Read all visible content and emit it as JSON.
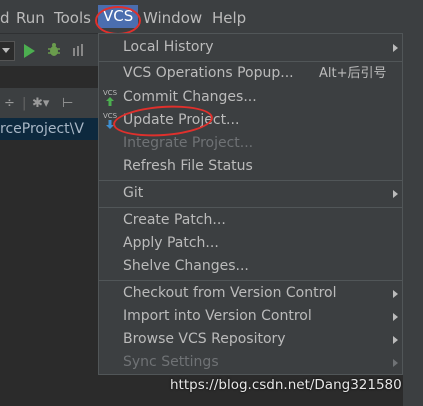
{
  "menubar": {
    "items": [
      "d",
      "Run",
      "Tools",
      "VCS",
      "Window",
      "Help"
    ]
  },
  "left_panel": {
    "project_path": "rceProject\\V"
  },
  "vcs_menu": {
    "items": [
      {
        "label": "Local History",
        "has_submenu": true,
        "enabled": true
      },
      {
        "label": "VCS Operations Popup...",
        "shortcut": "Alt+后引号",
        "enabled": true
      },
      {
        "label": "Commit Changes...",
        "icon": "vcs-commit-icon",
        "enabled": true
      },
      {
        "label": "Update Project...",
        "icon": "vcs-update-icon",
        "enabled": true
      },
      {
        "label": "Integrate Project...",
        "enabled": false
      },
      {
        "label": "Refresh File Status",
        "enabled": true
      },
      {
        "label": "Git",
        "has_submenu": true,
        "enabled": true
      },
      {
        "label": "Create Patch...",
        "enabled": true
      },
      {
        "label": "Apply Patch...",
        "enabled": true
      },
      {
        "label": "Shelve Changes...",
        "enabled": true
      },
      {
        "label": "Checkout from Version Control",
        "has_submenu": true,
        "enabled": true
      },
      {
        "label": "Import into Version Control",
        "has_submenu": true,
        "enabled": true
      },
      {
        "label": "Browse VCS Repository",
        "has_submenu": true,
        "enabled": true
      },
      {
        "label": "Sync Settings",
        "has_submenu": true,
        "enabled": false
      }
    ],
    "icon_text": "VCS"
  },
  "watermark": "https://blog.csdn.net/Dang321580",
  "colors": {
    "background": "#2b2b2b",
    "menu_bg": "#3c3f41",
    "highlight": "#4b6eaf",
    "annotation": "#e0302c",
    "commit_arrow": "#4caf50",
    "update_arrow": "#3d8fd1"
  }
}
